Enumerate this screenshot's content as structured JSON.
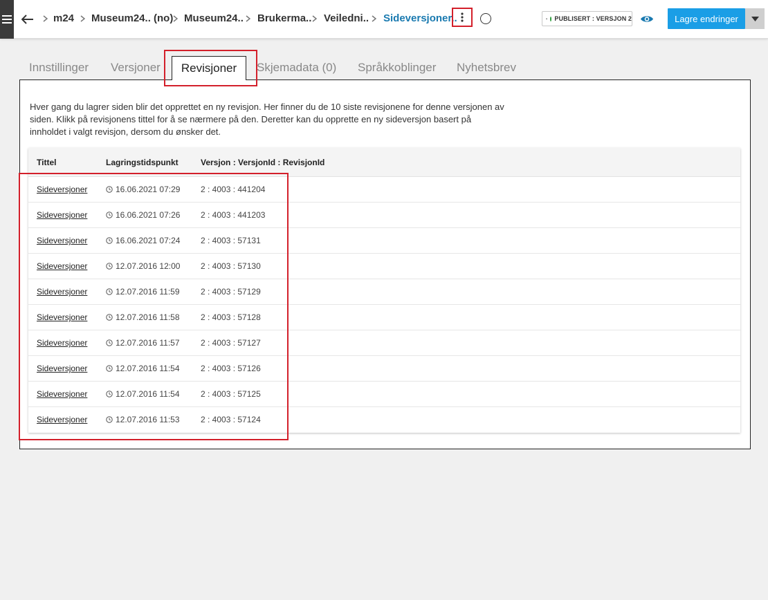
{
  "topbar": {
    "menu_icon": "hamburger-menu-icon",
    "back_icon": "arrow-left-icon",
    "breadcrumbs": [
      {
        "label": "m24"
      },
      {
        "label": "Museum24.. (no)"
      },
      {
        "label": "Museum24.."
      },
      {
        "label": "Brukerma.."
      },
      {
        "label": "Veiledni.."
      },
      {
        "label": "Sideversjoner.."
      }
    ],
    "status_label": "PUBLISERT : VERSJON 2",
    "save_label": "Lagre endringer",
    "accent_color": "#1a9ee6",
    "status_color": "#2e9e3e"
  },
  "tabs": [
    {
      "label": "Innstillinger"
    },
    {
      "label": "Versjoner"
    },
    {
      "label": "Revisjoner"
    },
    {
      "label": "Skjemadata (0)"
    },
    {
      "label": "Språkkoblinger"
    },
    {
      "label": "Nyhetsbrev"
    }
  ],
  "intro_text": "Hver gang du lagrer siden blir det opprettet en ny revisjon. Her finner du de 10 siste revisjonene for denne versjonen av siden. Klikk på revisjonens tittel for å se nærmere på den. Deretter kan du opprette en ny sideversjon basert på innholdet i valgt revisjon, dersom du ønsker det.",
  "table": {
    "headers": {
      "title": "Tittel",
      "time": "Lagringstidspunkt",
      "version": "Versjon : VersjonId : RevisjonId"
    },
    "rows": [
      {
        "title": "Sideversjoner",
        "time": "16.06.2021 07:29",
        "version": "2 : 4003 : 441204"
      },
      {
        "title": "Sideversjoner",
        "time": "16.06.2021 07:26",
        "version": "2 : 4003 : 441203"
      },
      {
        "title": "Sideversjoner",
        "time": "16.06.2021 07:24",
        "version": "2 : 4003 : 57131"
      },
      {
        "title": "Sideversjoner",
        "time": "12.07.2016 12:00",
        "version": "2 : 4003 : 57130"
      },
      {
        "title": "Sideversjoner",
        "time": "12.07.2016 11:59",
        "version": "2 : 4003 : 57129"
      },
      {
        "title": "Sideversjoner",
        "time": "12.07.2016 11:58",
        "version": "2 : 4003 : 57128"
      },
      {
        "title": "Sideversjoner",
        "time": "12.07.2016 11:57",
        "version": "2 : 4003 : 57127"
      },
      {
        "title": "Sideversjoner",
        "time": "12.07.2016 11:54",
        "version": "2 : 4003 : 57126"
      },
      {
        "title": "Sideversjoner",
        "time": "12.07.2016 11:54",
        "version": "2 : 4003 : 57125"
      },
      {
        "title": "Sideversjoner",
        "time": "12.07.2016 11:53",
        "version": "2 : 4003 : 57124"
      }
    ]
  }
}
